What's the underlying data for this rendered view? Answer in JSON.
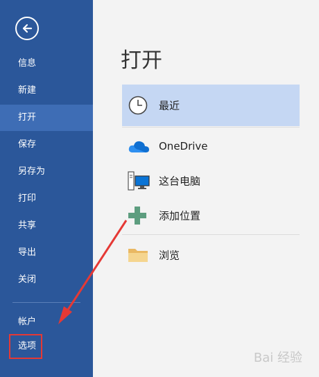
{
  "sidebar": {
    "items": [
      {
        "label": "信息"
      },
      {
        "label": "新建"
      },
      {
        "label": "打开"
      },
      {
        "label": "保存"
      },
      {
        "label": "另存为"
      },
      {
        "label": "打印"
      },
      {
        "label": "共享"
      },
      {
        "label": "导出"
      },
      {
        "label": "关闭"
      },
      {
        "label": "帐户"
      },
      {
        "label": "选项"
      }
    ],
    "active_index": 2
  },
  "main": {
    "title": "打开",
    "locations": [
      {
        "label": "最近",
        "icon": "clock-icon"
      },
      {
        "label": "OneDrive",
        "icon": "cloud-icon"
      },
      {
        "label": "这台电脑",
        "icon": "computer-icon"
      },
      {
        "label": "添加位置",
        "icon": "plus-icon"
      },
      {
        "label": "浏览",
        "icon": "folder-icon"
      }
    ]
  },
  "colors": {
    "sidebar_bg": "#2b579a",
    "sidebar_active": "#3e6db5",
    "selected_row": "#c5d7f3",
    "annotation_red": "#e53935"
  },
  "watermark": "Bai 经验"
}
